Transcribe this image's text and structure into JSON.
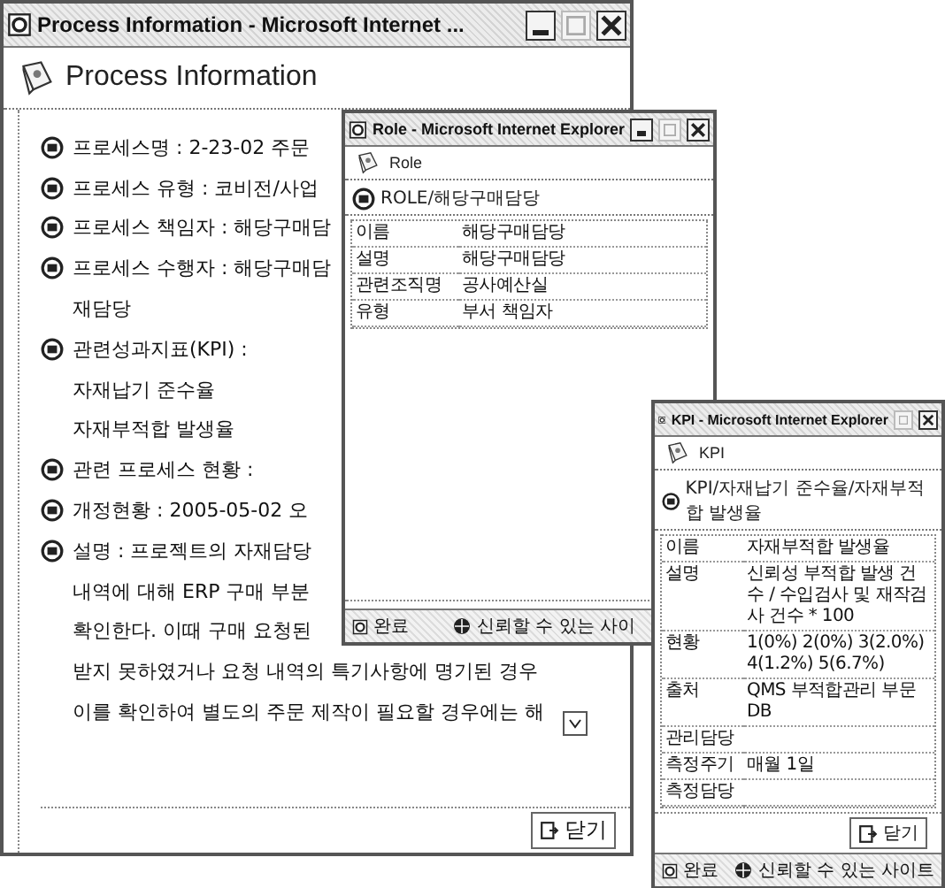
{
  "main_window": {
    "title": "Process Information - Microsoft Internet ...",
    "header": "Process Information",
    "lines": [
      {
        "kind": "bullet",
        "text": "프로세스명 : 2-23-02 주문"
      },
      {
        "kind": "bullet",
        "text": "프로세스 유형 : 코비전/사업"
      },
      {
        "kind": "bullet",
        "text": "프로세스 책임자 : 해당구매담"
      },
      {
        "kind": "bullet",
        "text": "프로세스 수행자 : 해당구매담"
      },
      {
        "kind": "continuation",
        "text": "재담당"
      },
      {
        "kind": "bullet",
        "text": "관련성과지표(KPI) :"
      },
      {
        "kind": "continuation",
        "text": "자재납기 준수율"
      },
      {
        "kind": "continuation",
        "text": "자재부적합 발생율"
      },
      {
        "kind": "bullet",
        "text": "관련 프로세스 현황 :"
      },
      {
        "kind": "bullet",
        "text": "개정현황 : 2005-05-02 오"
      },
      {
        "kind": "bullet",
        "text": "설명 : 프로젝트의 자재담당"
      },
      {
        "kind": "continuation",
        "text": "내역에 대해 ERP 구매 부분"
      },
      {
        "kind": "continuation",
        "text": "확인한다. 이때 구매 요청된"
      },
      {
        "kind": "continuation",
        "text": "받지 못하였거나 요청 내역의 특기사항에 명기된 경우"
      },
      {
        "kind": "continuation",
        "text": "이를 확인하여 별도의 주문 제작이 필요할 경우에는 해"
      }
    ],
    "close_button": "닫기"
  },
  "role_window": {
    "title": "Role - Microsoft Internet Explorer",
    "header": "Role",
    "breadcrumb": "ROLE/해당구매담당",
    "rows": [
      {
        "label": "이름",
        "value": "해당구매담당"
      },
      {
        "label": "설명",
        "value": "해당구매담당"
      },
      {
        "label": "관련조직명",
        "value": "공사예산실"
      },
      {
        "label": "유형",
        "value": "부서 책임자"
      }
    ],
    "status": "완료",
    "zone": "신뢰할 수 있는 사이"
  },
  "kpi_window": {
    "title": "KPI - Microsoft Internet Explorer",
    "header": "KPI",
    "breadcrumb": "KPI/자재납기 준수율/자재부적합 발생율",
    "rows": [
      {
        "label": "이름",
        "value": "자재부적합 발생율"
      },
      {
        "label": "설명",
        "value": "신뢰성 부적합 발생 건수 / 수입검사 및 재작검사 건수 * 100"
      },
      {
        "label": "현황",
        "value": "1(0%) 2(0%) 3(2.0%) 4(1.2%) 5(6.7%)"
      },
      {
        "label": "출처",
        "value": "QMS 부적합관리 부문 DB"
      },
      {
        "label": "관리담당"
      },
      {
        "label": "측정주기",
        "value": "매월 1일"
      },
      {
        "label": "측정담당"
      }
    ],
    "close_button": "닫기",
    "status": "완료",
    "zone": "신뢰할 수 있는 사이트"
  }
}
